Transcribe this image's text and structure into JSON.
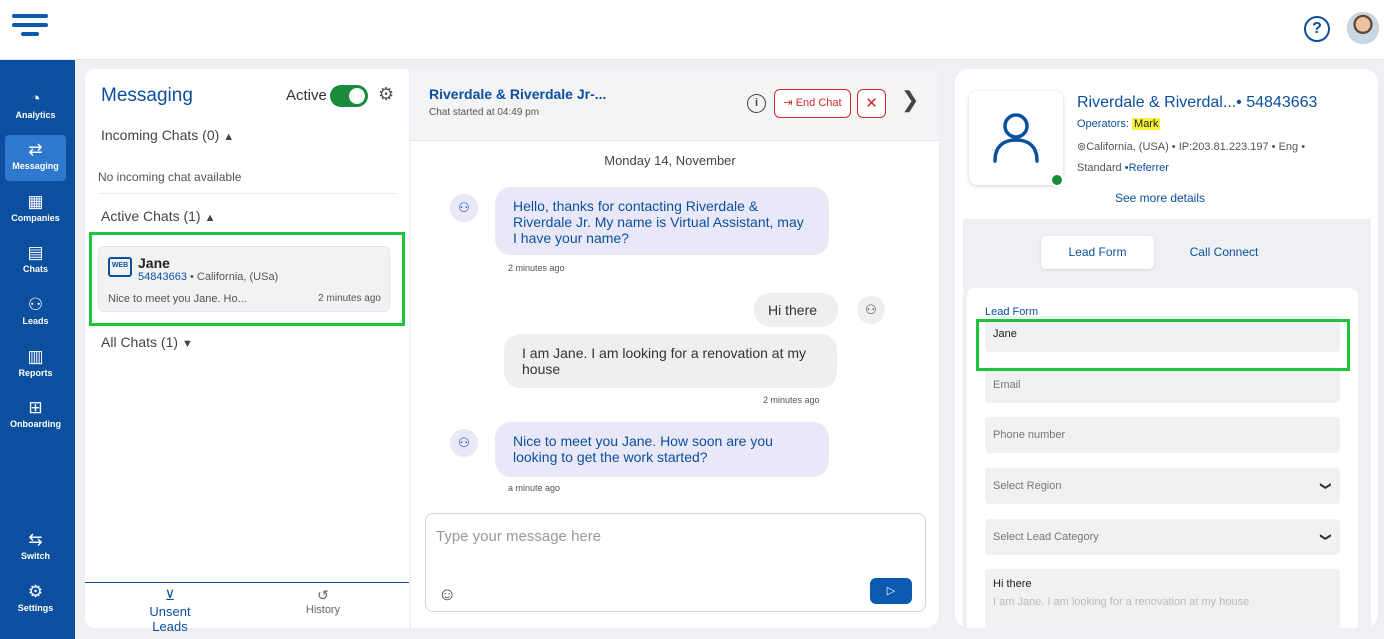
{
  "topbar": {
    "help_glyph": "?",
    "avatar_name": "avatar"
  },
  "nav": [
    {
      "label": "Analytics",
      "icon": "analytics-icon",
      "glyph": "◔",
      "active": false
    },
    {
      "label": "Messaging",
      "icon": "messaging-icon",
      "glyph": "⇄",
      "active": true
    },
    {
      "label": "Companies",
      "icon": "companies-icon",
      "glyph": "▦",
      "active": false
    },
    {
      "label": "Chats",
      "icon": "chats-icon",
      "glyph": "▤",
      "active": false
    },
    {
      "label": "Leads",
      "icon": "leads-icon",
      "glyph": "⚇",
      "active": false
    },
    {
      "label": "Reports",
      "icon": "reports-icon",
      "glyph": "▥",
      "active": false
    },
    {
      "label": "Onboarding",
      "icon": "onboarding-icon",
      "glyph": "⊞",
      "active": false
    },
    {
      "label": "Switch",
      "icon": "switch-icon",
      "glyph": "⇆",
      "active": false
    },
    {
      "label": "Settings",
      "icon": "settings-icon",
      "glyph": "⚙",
      "active": false
    }
  ],
  "messaging": {
    "title": "Messaging",
    "active_label": "Active",
    "incoming_header": "Incoming Chats (0)",
    "no_incoming": "No incoming chat available",
    "active_header": "Active Chats (1)",
    "all_header": "All Chats (1)",
    "card": {
      "source_badge": "WEB",
      "name": "Jane",
      "id": "54843663",
      "location": " • California, (USa)",
      "preview": "Nice to meet you Jane. Ho...",
      "time": "2 minutes ago"
    },
    "tabs": {
      "unsent": "Unsent Leads",
      "history": "History"
    }
  },
  "chat": {
    "title": "Riverdale & Riverdale Jr-...",
    "subtitle": "Chat started at 04:49 pm",
    "end_chat": "End Chat",
    "date": "Monday 14, November",
    "messages": [
      {
        "from": "bot",
        "text": "Hello, thanks for contacting Riverdale & Riverdale Jr. My name is Virtual Assistant, may I have your name?",
        "time": "2 minutes ago"
      },
      {
        "from": "user",
        "text": "Hi there",
        "time": ""
      },
      {
        "from": "user",
        "text": "I am Jane. I am looking for a renovation at my house",
        "time": "2 minutes ago"
      },
      {
        "from": "bot",
        "text": "Nice to meet you Jane. How soon are you looking to get the work started?",
        "time": "a minute ago"
      }
    ],
    "composer_placeholder": "Type your message here"
  },
  "details": {
    "name": "Riverdale & Riverdal...• 54843663",
    "operators_label": "Operators: ",
    "operator": "Mark",
    "location_line": "California, (USA) • IP:203.81.223.197 • Eng •",
    "plan": "Standard",
    "referrer": " •Referrer",
    "see_more": "See more details",
    "tabs": {
      "lead_form": "Lead Form",
      "call_connect": "Call Connect"
    },
    "form": {
      "label": "Lead Form",
      "name_value": "Jane",
      "email_placeholder": "Email",
      "phone_placeholder": "Phone number",
      "region_placeholder": "Select Region",
      "category_placeholder": "Select Lead Category",
      "message_value": "Hi there",
      "message_faded": "I am Jane. I am looking for a renovation at my house"
    }
  }
}
